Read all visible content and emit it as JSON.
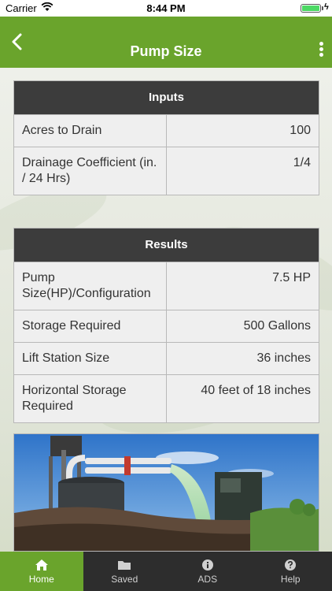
{
  "status_bar": {
    "carrier": "Carrier",
    "time": "8:44 PM"
  },
  "nav": {
    "title": "Pump Size"
  },
  "inputs": {
    "header": "Inputs",
    "rows": [
      {
        "label": "Acres to Drain",
        "value": "100"
      },
      {
        "label": "Drainage Coefficient (in. / 24 Hrs)",
        "value": "1/4"
      }
    ]
  },
  "results": {
    "header": "Results",
    "rows": [
      {
        "label": "Pump Size(HP)/Configuration",
        "value": "7.5 HP"
      },
      {
        "label": "Storage Required",
        "value": "500 Gallons"
      },
      {
        "label": "Lift Station Size",
        "value": "36 inches"
      },
      {
        "label": "Horizontal Storage Required",
        "value": "40 feet of 18 inches"
      }
    ]
  },
  "tabs": [
    {
      "label": "Home",
      "icon": "home-icon",
      "active": true
    },
    {
      "label": "Saved",
      "icon": "folder-icon",
      "active": false
    },
    {
      "label": "ADS",
      "icon": "info-icon",
      "active": false
    },
    {
      "label": "Help",
      "icon": "help-icon",
      "active": false
    }
  ],
  "colors": {
    "accent": "#6aa42c",
    "header_dark": "#3c3c3c",
    "tab_bar": "#2d2d2d"
  }
}
